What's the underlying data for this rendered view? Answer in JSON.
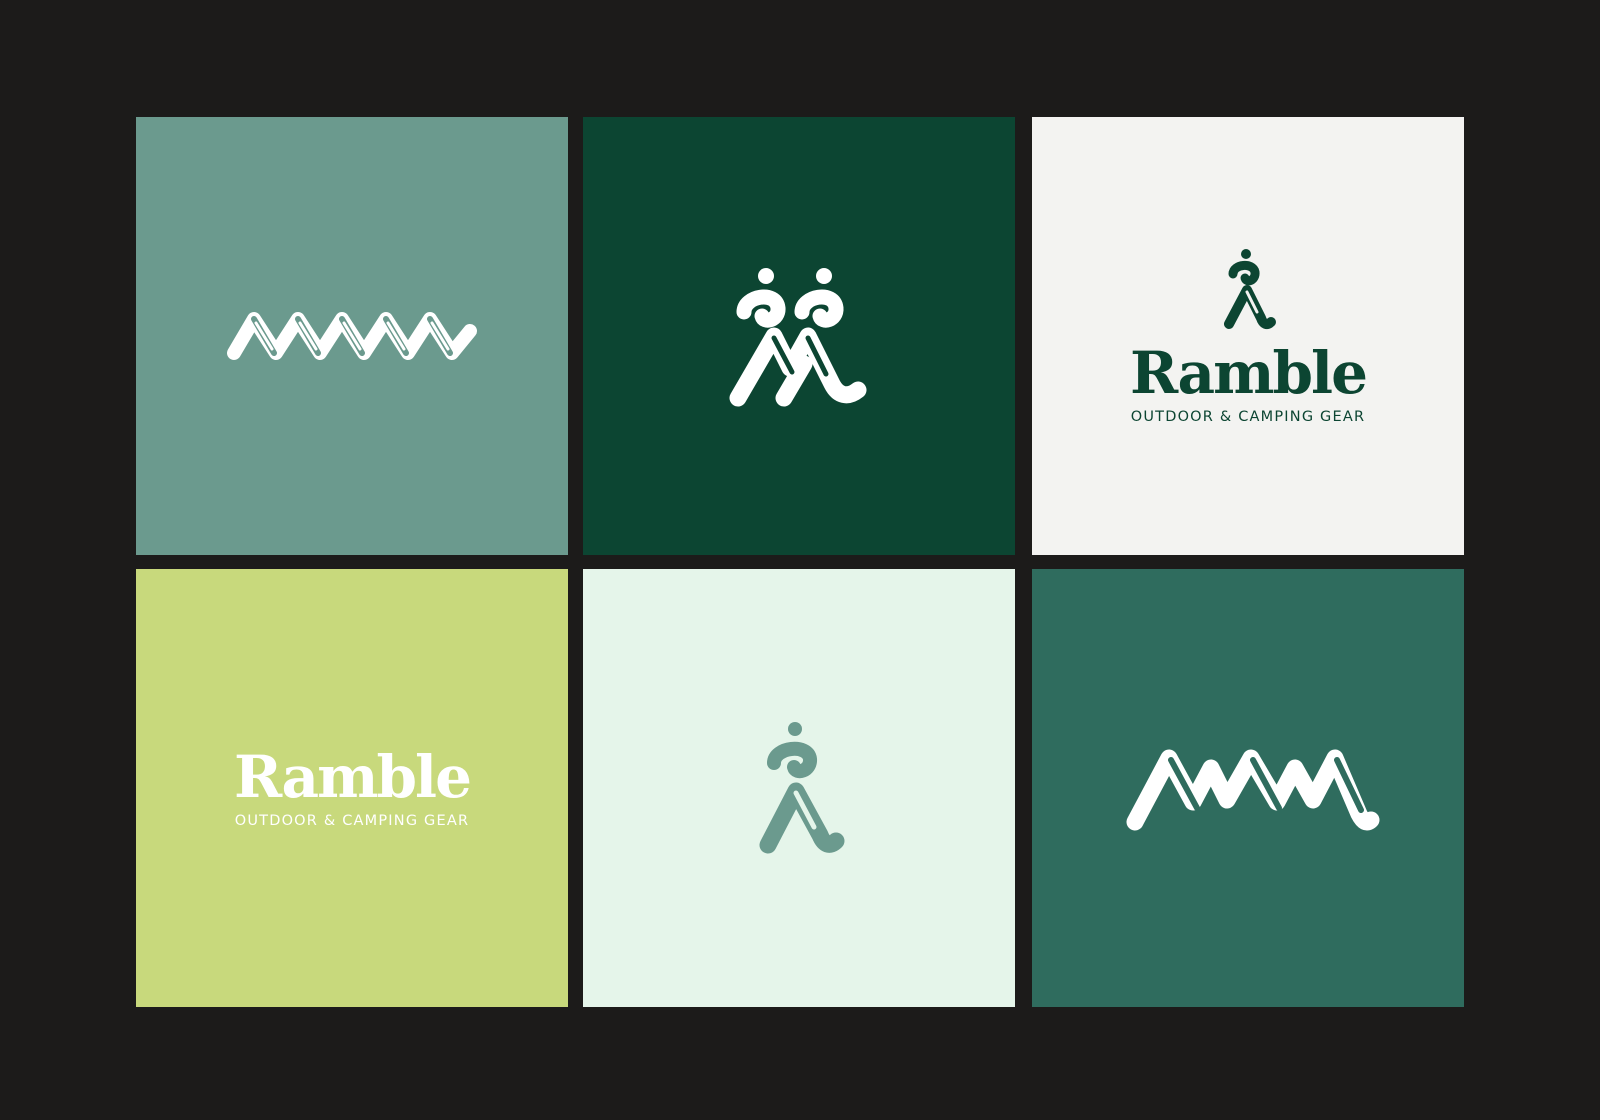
{
  "brand": {
    "name": "Ramble",
    "tagline": "OUTDOOR & CAMPING GEAR"
  },
  "colors": {
    "background": "#1c1b1a",
    "sage": "#6b9a8e",
    "forest": "#0c4532",
    "off_white": "#f3f3f1",
    "lime": "#c8d97c",
    "mint": "#e5f5ea",
    "teal": "#2f6c5e",
    "white": "#ffffff"
  },
  "tiles": [
    {
      "id": "t1",
      "bg": "sage",
      "content": "zigzag-mark",
      "ink": "white"
    },
    {
      "id": "t2",
      "bg": "forest",
      "content": "double-hiker-mark",
      "ink": "white"
    },
    {
      "id": "t3",
      "bg": "off_white",
      "content": "hiker-logo-lockup",
      "ink": "forest"
    },
    {
      "id": "t4",
      "bg": "lime",
      "content": "wordmark-lockup",
      "ink": "white"
    },
    {
      "id": "t5",
      "bg": "mint",
      "content": "hiker-mark",
      "ink": "sage"
    },
    {
      "id": "t6",
      "bg": "teal",
      "content": "mountain-zigzag-mark",
      "ink": "white"
    }
  ]
}
